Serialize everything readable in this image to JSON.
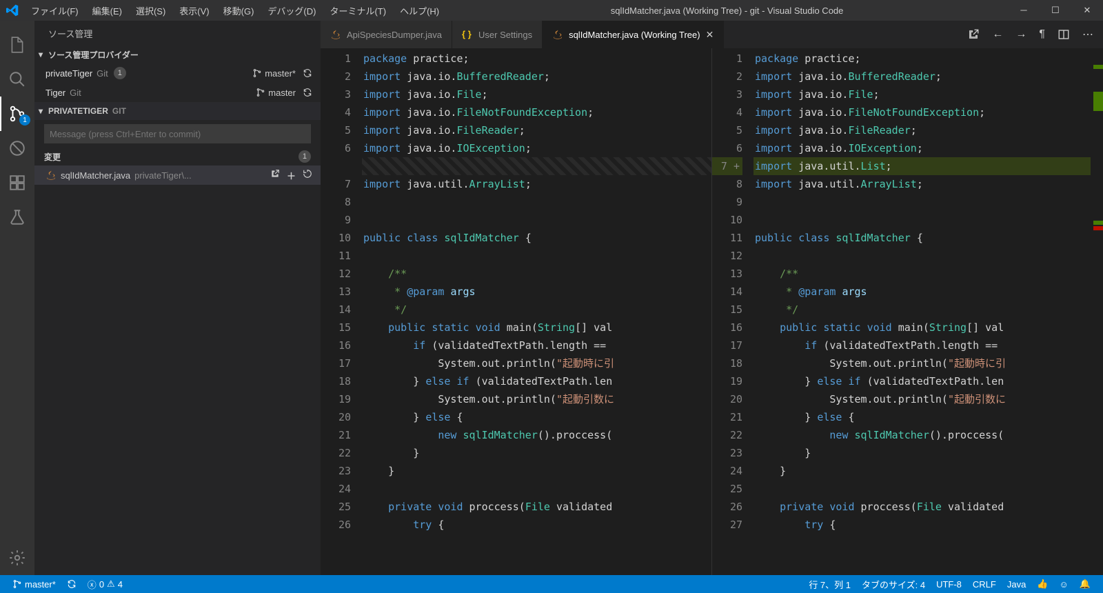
{
  "window": {
    "title": "sqlIdMatcher.java (Working Tree) - git - Visual Studio Code"
  },
  "menu": {
    "file": "ファイル(F)",
    "edit": "編集(E)",
    "select": "選択(S)",
    "view": "表示(V)",
    "go": "移動(G)",
    "debug": "デバッグ(D)",
    "terminal": "ターミナル(T)",
    "help": "ヘルプ(H)"
  },
  "activity": {
    "scm_badge": "1"
  },
  "sidebar": {
    "title": "ソース管理",
    "provider_header": "ソース管理プロバイダー",
    "providers": [
      {
        "name": "privateTiger",
        "kind": "Git",
        "count": "1",
        "branch": "master*"
      },
      {
        "name": "Tiger",
        "kind": "Git",
        "branch": "master"
      }
    ],
    "repo_header_name": "PRIVATETIGER",
    "repo_header_kind": "GIT",
    "message_placeholder": "Message (press Ctrl+Enter to commit)",
    "changes_label": "変更",
    "changes_count": "1",
    "changed_file": "sqlIdMatcher.java",
    "changed_path": "privateTiger\\..."
  },
  "tabs": [
    {
      "label": "ApiSpeciesDumper.java",
      "icon": "java",
      "active": false
    },
    {
      "label": "User Settings",
      "icon": "json",
      "active": false
    },
    {
      "label": "sqlIdMatcher.java (Working Tree)",
      "icon": "java",
      "active": true
    }
  ],
  "editor": {
    "left_lines": [
      "1",
      "2",
      "3",
      "4",
      "5",
      "6",
      "",
      "7",
      "8",
      "9",
      "10",
      "11",
      "12",
      "13",
      "14",
      "15",
      "16",
      "17",
      "18",
      "19",
      "20",
      "21",
      "22",
      "23",
      "24",
      "25",
      "26"
    ],
    "right_lines": [
      "1",
      "2",
      "3",
      "4",
      "5",
      "6",
      "7",
      "8",
      "9",
      "10",
      "11",
      "12",
      "13",
      "14",
      "15",
      "16",
      "17",
      "18",
      "19",
      "20",
      "21",
      "22",
      "23",
      "24",
      "25",
      "26",
      "27"
    ],
    "right_added_label": "+"
  },
  "status": {
    "branch": "master*",
    "errors": "0",
    "warnings": "4",
    "cursor": "行 7、列 1",
    "tabsize": "タブのサイズ: 4",
    "encoding": "UTF-8",
    "eol": "CRLF",
    "lang": "Java"
  }
}
